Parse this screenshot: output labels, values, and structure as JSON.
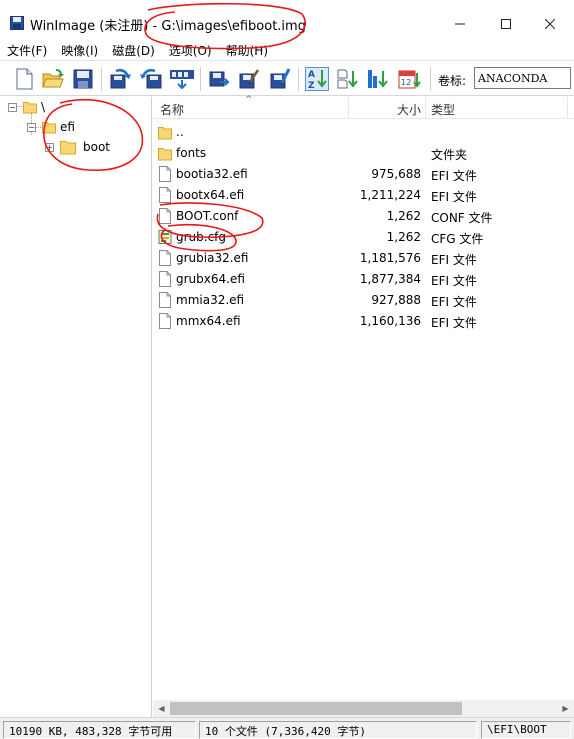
{
  "window": {
    "app_name": "WinImage (未注册) - ",
    "file_path": "G:\\images\\efiboot.img",
    "controls": {
      "minimize": "—",
      "maximize": "☐",
      "close": "✕"
    }
  },
  "menu": [
    {
      "label": "文件(F)"
    },
    {
      "label": "映像(I)"
    },
    {
      "label": "磁盘(D)"
    },
    {
      "label": "选项(O)"
    },
    {
      "label": "帮助(H)"
    }
  ],
  "toolbar": {
    "volume_label_caption": "卷标:",
    "volume_label_value": "ANACONDA"
  },
  "tree": {
    "root": "\\",
    "efi": "efi",
    "boot": "boot"
  },
  "list": {
    "headers": {
      "name": "名称",
      "size": "大小",
      "type": "类型"
    },
    "rows": [
      {
        "name": "..",
        "size": "",
        "type": ""
      },
      {
        "name": "fonts",
        "size": "",
        "type": "文件夹"
      },
      {
        "name": "bootia32.efi",
        "size": "975,688",
        "type": "EFI 文件"
      },
      {
        "name": "bootx64.efi",
        "size": "1,211,224",
        "type": "EFI 文件"
      },
      {
        "name": "BOOT.conf",
        "size": "1,262",
        "type": "CONF 文件"
      },
      {
        "name": "grub.cfg",
        "size": "1,262",
        "type": "CFG 文件"
      },
      {
        "name": "grubia32.efi",
        "size": "1,181,576",
        "type": "EFI 文件"
      },
      {
        "name": "grubx64.efi",
        "size": "1,877,384",
        "type": "EFI 文件"
      },
      {
        "name": "mmia32.efi",
        "size": "927,888",
        "type": "EFI 文件"
      },
      {
        "name": "mmx64.efi",
        "size": "1,160,136",
        "type": "EFI 文件"
      }
    ]
  },
  "scrollbar": {
    "left": "◀",
    "right": "▶"
  },
  "status": {
    "free_space": "10190 KB, 483,328 字节可用",
    "file_count": "10 个文件 (7,336,420 字节)",
    "current_path": "\\EFI\\BOOT"
  },
  "colors": {
    "folder": "#f7d675",
    "annotation": "#e8191b",
    "accent_blue": "#1e6fd0"
  }
}
